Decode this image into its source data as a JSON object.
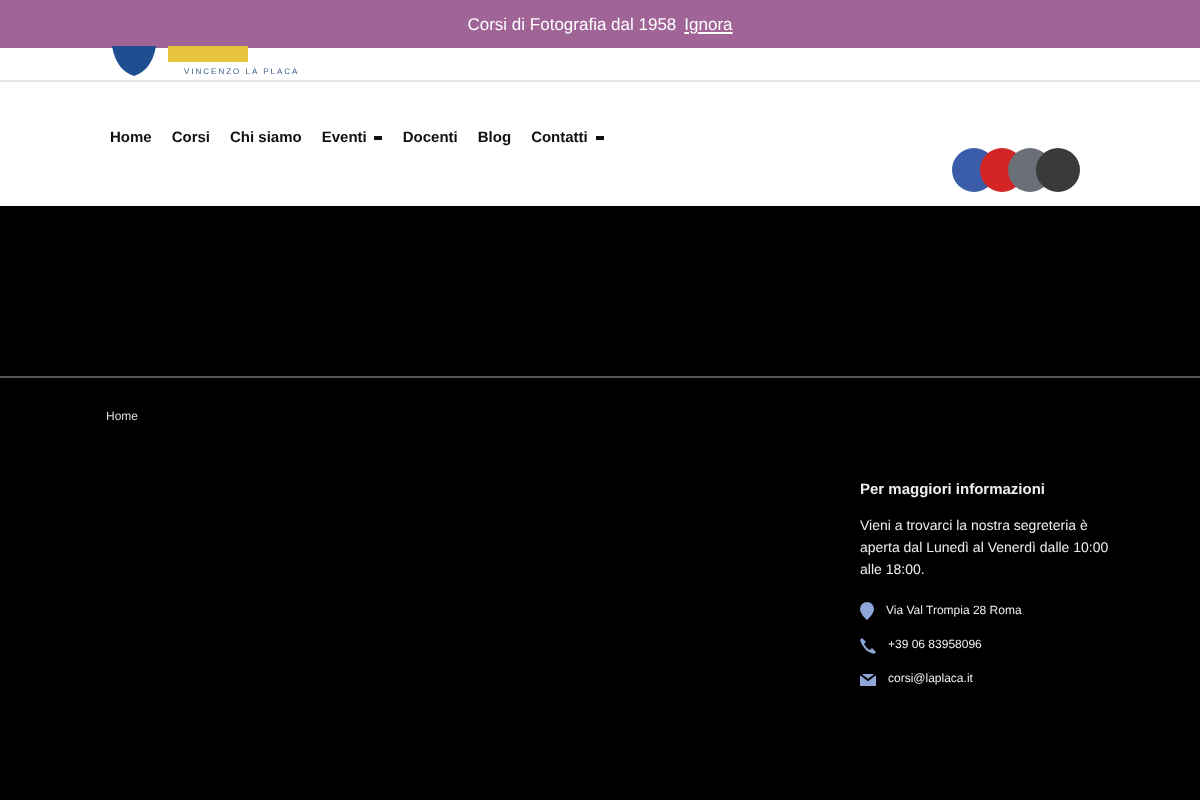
{
  "banner": {
    "text": "Corsi di Fotografia dal 1958",
    "link": "Ignora"
  },
  "logo": {
    "tagline": "VINCENZO LA PLACA"
  },
  "nav": [
    {
      "label": "Home",
      "dropdown": false
    },
    {
      "label": "Corsi",
      "dropdown": false
    },
    {
      "label": "Chi siamo",
      "dropdown": false
    },
    {
      "label": "Eventi",
      "dropdown": true
    },
    {
      "label": "Docenti",
      "dropdown": false
    },
    {
      "label": "Blog",
      "dropdown": false
    },
    {
      "label": "Contatti",
      "dropdown": true
    }
  ],
  "social": [
    {
      "kind": "facebook"
    },
    {
      "kind": "youtube"
    },
    {
      "kind": "tripadvisor"
    },
    {
      "kind": "instagram"
    }
  ],
  "footer": {
    "breadcrumb": "Home",
    "info": {
      "title": "Per maggiori informazioni",
      "text": "Vieni a trovarci la nostra segreteria è aperta dal Lunedì al Venerdì dalle 10:00 alle 18:00.",
      "contacts": [
        {
          "kind": "address",
          "text": "Via Val Trompia 28 Roma"
        },
        {
          "kind": "phone",
          "text": "+39 06 83958096"
        },
        {
          "kind": "email",
          "text": "corsi@laplaca.it"
        }
      ]
    }
  }
}
